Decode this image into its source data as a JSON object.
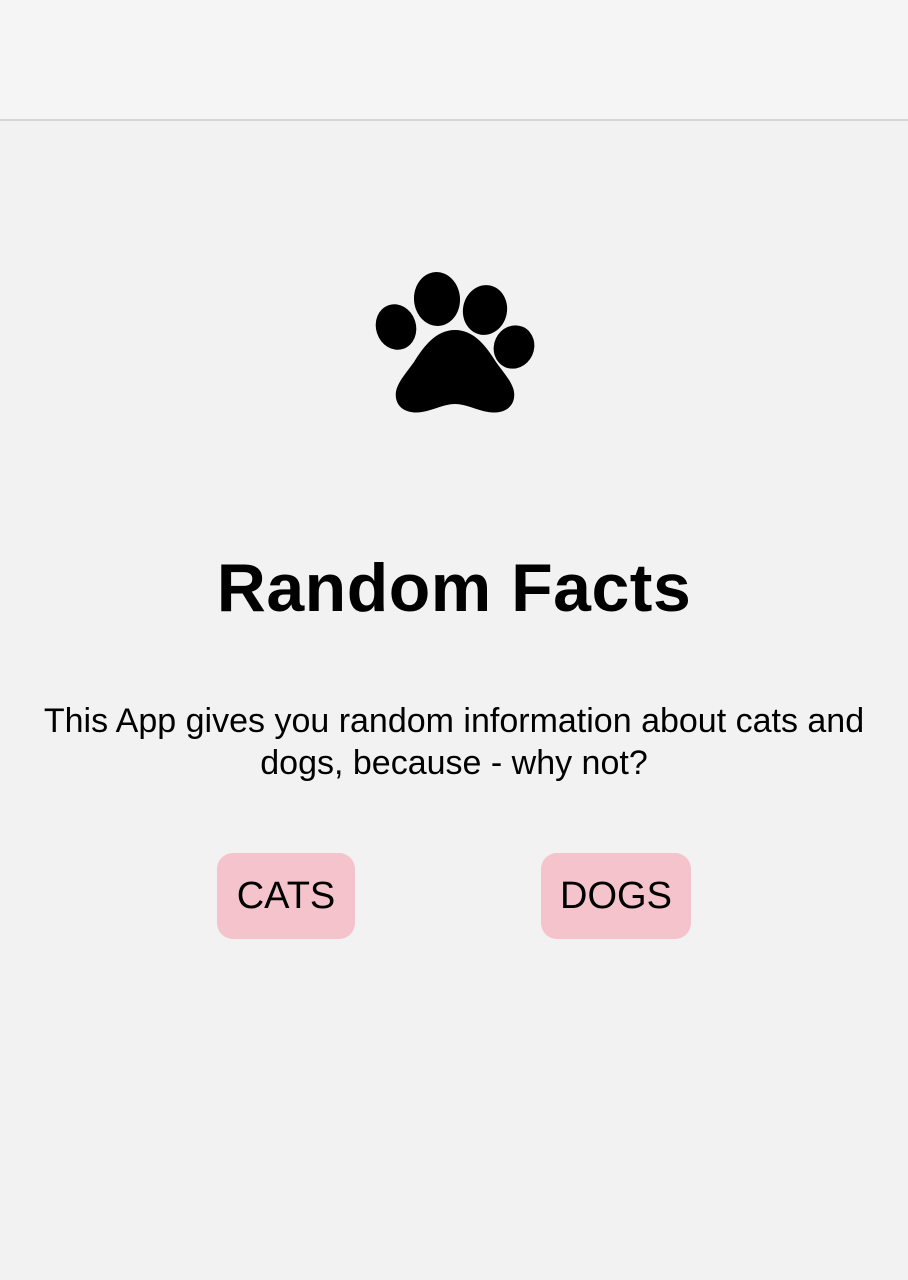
{
  "title": "Random Facts",
  "description": "This App gives you random information about cats and dogs, because - why not?",
  "buttons": {
    "cats": "CATS",
    "dogs": "DOGS"
  },
  "icons": {
    "hero": "paw-print-icon"
  },
  "colors": {
    "background": "#f2f2f2",
    "nav_bar": "#f5f5f5",
    "button": "#f4c3cb",
    "text": "#000000"
  }
}
